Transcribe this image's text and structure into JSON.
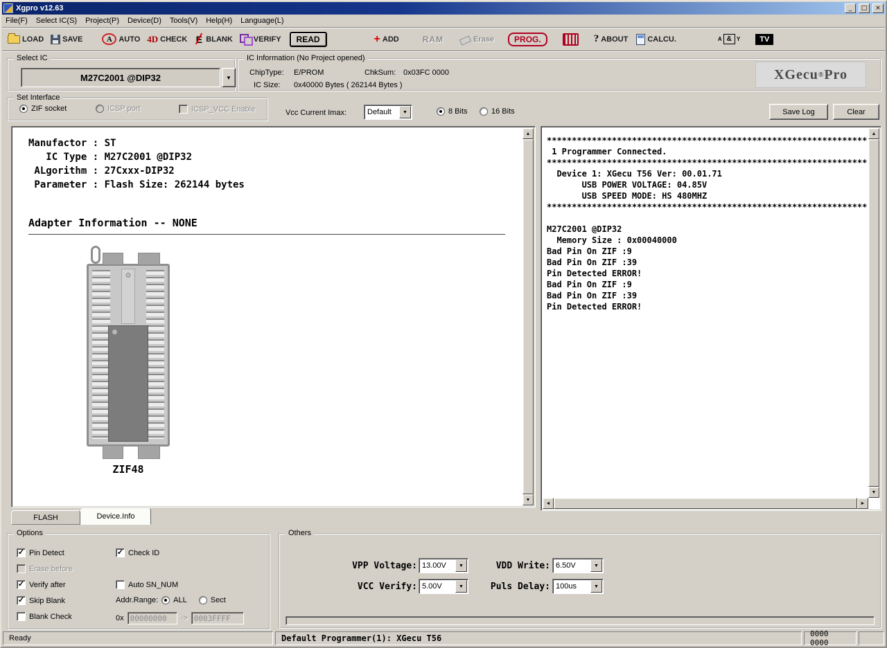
{
  "window": {
    "title": "Xgpro v12.63",
    "minimize": "_",
    "maximize": "□",
    "close": "×"
  },
  "menu": {
    "items": [
      "File(F)",
      "Select IC(S)",
      "Project(P)",
      "Device(D)",
      "Tools(V)",
      "Help(H)",
      "Language(L)"
    ]
  },
  "toolbar": {
    "load": "LOAD",
    "save": "SAVE",
    "auto": "AUTO",
    "check": "CHECK",
    "blank": "BLANK",
    "verify": "VERIFY",
    "read": "READ",
    "add": "ADD",
    "ram": "RAM",
    "erase": "Erase",
    "prog": "PROG.",
    "about": "ABOUT",
    "calcu": "CALCU.",
    "tv": "TV",
    "icons": {
      "auto_glyph": "A",
      "check_glyph": "4D",
      "blank_glyph": "E",
      "add_glyph": "+",
      "about_glyph": "?",
      "logic_in": "A",
      "logic_gate": "&",
      "logic_out": "Y"
    }
  },
  "ui": {
    "dropdown_glyph": "▼",
    "scroll_up": "▲",
    "scroll_down": "▼",
    "scroll_left": "◄",
    "scroll_right": "►"
  },
  "select_ic": {
    "title": "Select IC",
    "value": "M27C2001 @DIP32"
  },
  "ic_info": {
    "title": "IC Information (No Project opened)",
    "chip_type_label": "ChipType:",
    "chip_type": "E/PROM",
    "chksum_label": "ChkSum:",
    "chksum": "0x03FC 0000",
    "ic_size_label": "IC Size:",
    "ic_size": "0x40000 Bytes ( 262144 Bytes )",
    "logo_brand": "XGecu",
    "logo_reg": "®",
    "logo_pro": "Pro"
  },
  "interface": {
    "title": "Set Interface",
    "zif_label": "ZIF socket",
    "zif_checked": true,
    "icsp_label": "ICSP port",
    "icsp_checked": false,
    "icsp_vcc_label": "ICSP_VCC Enable",
    "icsp_vcc_checked": false,
    "vcc_imax_label": "Vcc Current Imax:",
    "vcc_imax_value": "Default",
    "bits8_label": "8 Bits",
    "bits8_checked": true,
    "bits16_label": "16 Bits",
    "bits16_checked": false,
    "save_log_label": "Save Log",
    "clear_label": "Clear"
  },
  "device_info": {
    "lines": [
      "Manufactor : ST",
      "   IC Type : M27C2001 @DIP32",
      " ALgorithm : 27Cxxx-DIP32",
      " Parameter : Flash Size: 262144 bytes"
    ],
    "adapter_heading": "Adapter Information -- NONE",
    "socket_label": "ZIF48"
  },
  "log": {
    "lines": [
      "****************************************************************",
      " 1 Programmer Connected.",
      "****************************************************************",
      "  Device 1: XGecu T56 Ver: 00.01.71",
      "       USB POWER VOLTAGE: 04.85V",
      "       USB SPEED MODE: HS 480MHZ",
      "****************************************************************",
      "",
      "M27C2001 @DIP32",
      "  Memory Size : 0x00040000",
      "Bad Pin On ZIF :9",
      "Bad Pin On ZIF :39",
      "Pin Detected ERROR!",
      "Bad Pin On ZIF :9",
      "Bad Pin On ZIF :39",
      "Pin Detected ERROR!"
    ]
  },
  "tabs": {
    "flash": "FLASH",
    "device_info": "Device.Info"
  },
  "options": {
    "title": "Options",
    "pin_detect": "Pin Detect",
    "pin_detect_checked": true,
    "check_id": "Check ID",
    "check_id_checked": true,
    "erase_before": "Erase before",
    "erase_before_checked": false,
    "verify_after": "Verify after",
    "verify_after_checked": true,
    "auto_sn": "Auto SN_NUM",
    "auto_sn_checked": false,
    "skip_blank": "Skip Blank",
    "skip_blank_checked": true,
    "blank_check": "Blank Check",
    "blank_check_checked": false,
    "addr_range_label": "Addr.Range:",
    "all_label": "ALL",
    "all_checked": true,
    "sect_label": "Sect",
    "sect_checked": false,
    "hex_prefix": "0x",
    "addr_from": "00000000",
    "arrow": "->",
    "addr_to": "0003FFFF"
  },
  "others": {
    "title": "Others",
    "vpp_label": "VPP Voltage:",
    "vpp_value": "13.00V",
    "vdd_label": "VDD Write:",
    "vdd_value": "6.50V",
    "vcc_label": "VCC Verify:",
    "vcc_value": "5.00V",
    "puls_label": "Puls Delay:",
    "puls_value": "100us"
  },
  "statusbar": {
    "ready": "Ready",
    "programmer": "Default Programmer(1): XGecu T56",
    "counter": "0000 0000"
  }
}
